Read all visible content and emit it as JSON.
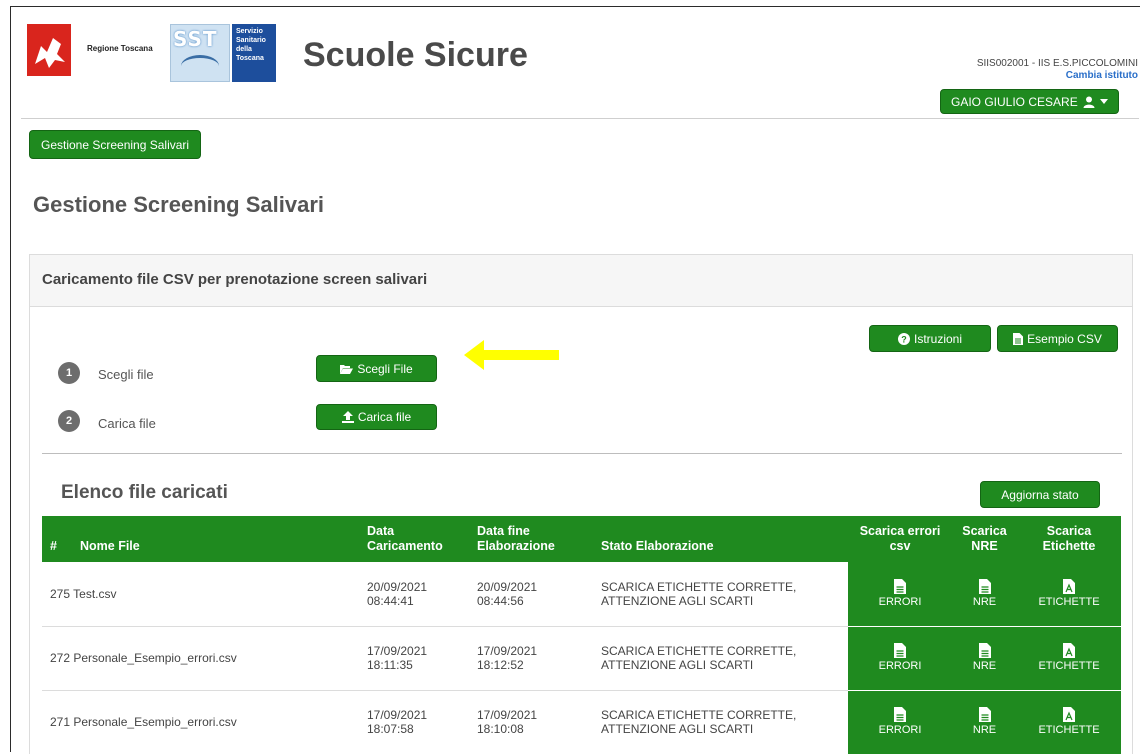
{
  "header": {
    "region_label": "Regione Toscana",
    "sst_label": "SST",
    "ssn_lines": [
      "Servizio",
      "Sanitario",
      "della",
      "Toscana"
    ],
    "app_title": "Scuole Sicure",
    "school": "SIIS002001 - IIS E.S.PICCOLOMINI",
    "change_school": "Cambia istituto",
    "user_name": "GAIO GIULIO CESARE"
  },
  "breadcrumb": {
    "label": "Gestione Screening Salivari"
  },
  "page": {
    "title": "Gestione Screening Salivari"
  },
  "panel": {
    "heading": "Caricamento file CSV per prenotazione screen salivari",
    "istruzioni_label": "Istruzioni",
    "esempio_label": "Esempio CSV",
    "steps": [
      {
        "num": "1",
        "label": "Scegli file",
        "button": "Scegli File"
      },
      {
        "num": "2",
        "label": "Carica file",
        "button": "Carica file"
      }
    ],
    "list_title": "Elenco file caricati",
    "refresh_label": "Aggiorna stato"
  },
  "table": {
    "headers": {
      "num": "#",
      "name": "Nome File",
      "upload_1": "Data",
      "upload_2": "Caricamento",
      "end_1": "Data fine",
      "end_2": "Elaborazione",
      "status": "Stato Elaborazione",
      "err_1": "Scarica errori",
      "err_2": "csv",
      "nre_1": "Scarica",
      "nre_2": "NRE",
      "lbl_1": "Scarica",
      "lbl_2": "Etichette"
    },
    "rows": [
      {
        "name": "275 Test.csv",
        "upload_date": "20/09/2021",
        "upload_time": "08:44:41",
        "end_date": "20/09/2021",
        "end_time": "08:44:56",
        "status_1": "SCARICA ETICHETTE CORRETTE,",
        "status_2": "ATTENZIONE AGLI SCARTI",
        "errors": "ERRORI",
        "nre": "NRE",
        "labels": "ETICHETTE"
      },
      {
        "name": "272 Personale_Esempio_errori.csv",
        "upload_date": "17/09/2021",
        "upload_time": "18:11:35",
        "end_date": "17/09/2021",
        "end_time": "18:12:52",
        "status_1": "SCARICA ETICHETTE CORRETTE,",
        "status_2": "ATTENZIONE AGLI SCARTI",
        "errors": "ERRORI",
        "nre": "NRE",
        "labels": "ETICHETTE"
      },
      {
        "name": "271 Personale_Esempio_errori.csv",
        "upload_date": "17/09/2021",
        "upload_time": "18:07:58",
        "end_date": "17/09/2021",
        "end_time": "18:10:08",
        "status_1": "SCARICA ETICHETTE CORRETTE,",
        "status_2": "ATTENZIONE AGLI SCARTI",
        "errors": "ERRORI",
        "nre": "NRE",
        "labels": "ETICHETTE"
      }
    ]
  },
  "colors": {
    "accent": "#1f8a1f",
    "arrow": "#ffff00",
    "link": "#2a6fc9"
  },
  "icons": [
    "question-icon",
    "file-icon",
    "folder-open-icon",
    "upload-icon",
    "user-icon",
    "caret-down-icon",
    "file-text-icon",
    "file-pdf-icon",
    "arrow-left-icon"
  ]
}
